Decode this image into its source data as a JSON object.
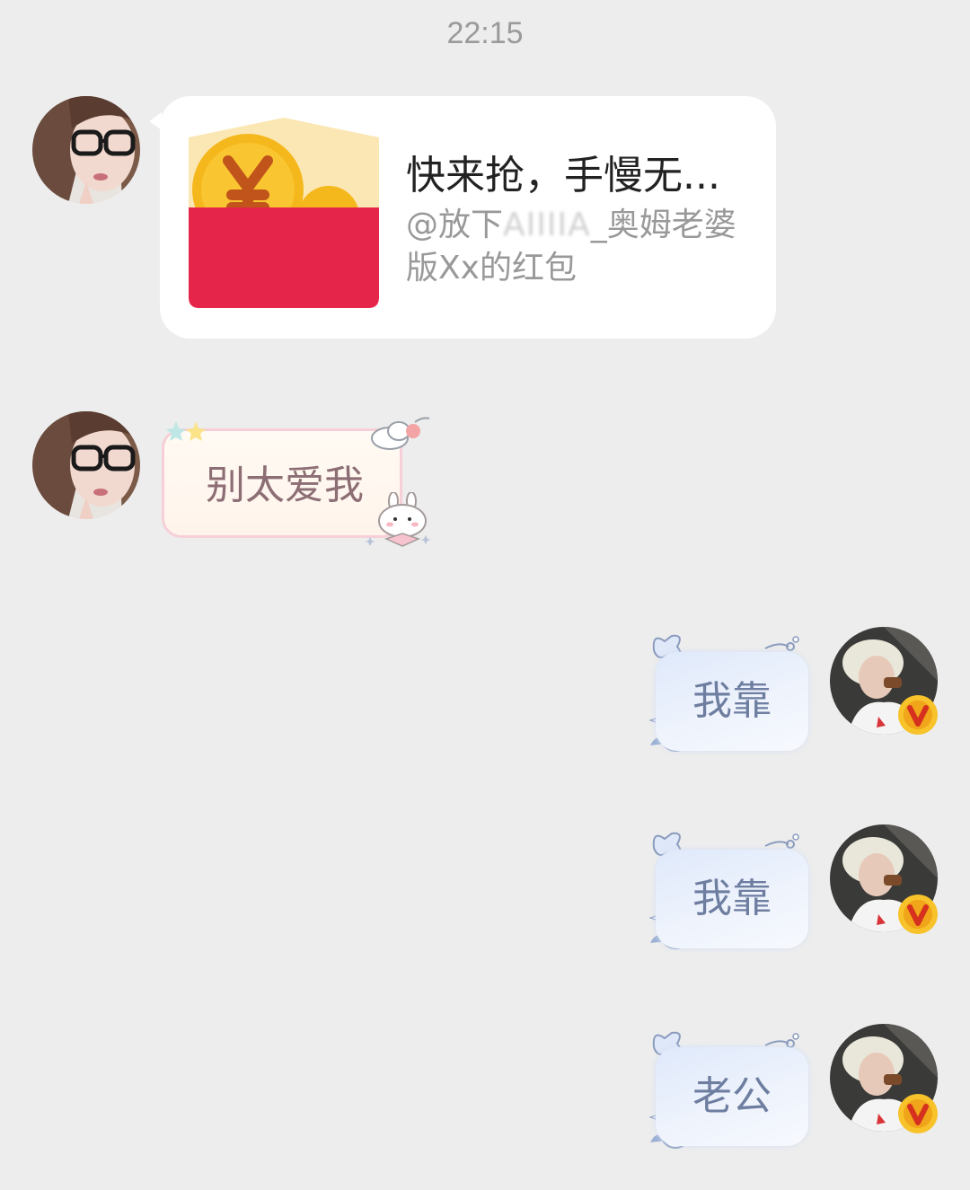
{
  "timestamp": "22:15",
  "red_packet": {
    "title": "快来抢，手慢无...",
    "sub_prefix": "@放下",
    "sub_masked": "AIIIIA",
    "sub_suffix": "_奥姆老婆版Xx的红包"
  },
  "messages": [
    {
      "side": "left",
      "text": "别太爱我"
    },
    {
      "side": "right",
      "text": "我靠"
    },
    {
      "side": "right",
      "text": "我靠"
    },
    {
      "side": "right",
      "text": "老公"
    }
  ],
  "colors": {
    "background": "#ededed",
    "packet_red": "#e6254a",
    "coin_gold": "#f5b81c",
    "verified_badge": "#f0a51a",
    "pink_border": "#f6cfd8",
    "blue_bubble": "#e6eefc"
  },
  "icons": {
    "verified": "verified-v-badge-icon",
    "red_packet": "red-envelope-icon"
  }
}
